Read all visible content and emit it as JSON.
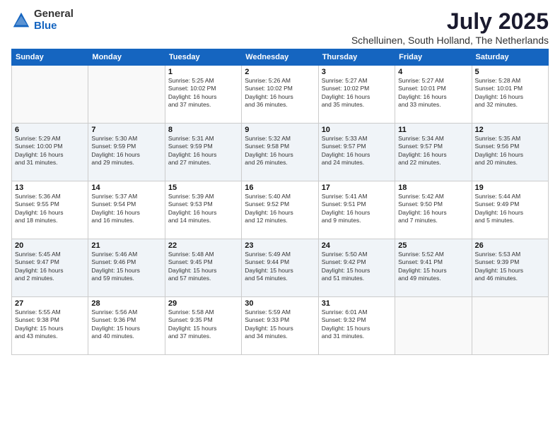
{
  "logo": {
    "general": "General",
    "blue": "Blue"
  },
  "title": "July 2025",
  "subtitle": "Schelluinen, South Holland, The Netherlands",
  "days_of_week": [
    "Sunday",
    "Monday",
    "Tuesday",
    "Wednesday",
    "Thursday",
    "Friday",
    "Saturday"
  ],
  "weeks": [
    [
      {
        "day": "",
        "info": ""
      },
      {
        "day": "",
        "info": ""
      },
      {
        "day": "1",
        "info": "Sunrise: 5:25 AM\nSunset: 10:02 PM\nDaylight: 16 hours\nand 37 minutes."
      },
      {
        "day": "2",
        "info": "Sunrise: 5:26 AM\nSunset: 10:02 PM\nDaylight: 16 hours\nand 36 minutes."
      },
      {
        "day": "3",
        "info": "Sunrise: 5:27 AM\nSunset: 10:02 PM\nDaylight: 16 hours\nand 35 minutes."
      },
      {
        "day": "4",
        "info": "Sunrise: 5:27 AM\nSunset: 10:01 PM\nDaylight: 16 hours\nand 33 minutes."
      },
      {
        "day": "5",
        "info": "Sunrise: 5:28 AM\nSunset: 10:01 PM\nDaylight: 16 hours\nand 32 minutes."
      }
    ],
    [
      {
        "day": "6",
        "info": "Sunrise: 5:29 AM\nSunset: 10:00 PM\nDaylight: 16 hours\nand 31 minutes."
      },
      {
        "day": "7",
        "info": "Sunrise: 5:30 AM\nSunset: 9:59 PM\nDaylight: 16 hours\nand 29 minutes."
      },
      {
        "day": "8",
        "info": "Sunrise: 5:31 AM\nSunset: 9:59 PM\nDaylight: 16 hours\nand 27 minutes."
      },
      {
        "day": "9",
        "info": "Sunrise: 5:32 AM\nSunset: 9:58 PM\nDaylight: 16 hours\nand 26 minutes."
      },
      {
        "day": "10",
        "info": "Sunrise: 5:33 AM\nSunset: 9:57 PM\nDaylight: 16 hours\nand 24 minutes."
      },
      {
        "day": "11",
        "info": "Sunrise: 5:34 AM\nSunset: 9:57 PM\nDaylight: 16 hours\nand 22 minutes."
      },
      {
        "day": "12",
        "info": "Sunrise: 5:35 AM\nSunset: 9:56 PM\nDaylight: 16 hours\nand 20 minutes."
      }
    ],
    [
      {
        "day": "13",
        "info": "Sunrise: 5:36 AM\nSunset: 9:55 PM\nDaylight: 16 hours\nand 18 minutes."
      },
      {
        "day": "14",
        "info": "Sunrise: 5:37 AM\nSunset: 9:54 PM\nDaylight: 16 hours\nand 16 minutes."
      },
      {
        "day": "15",
        "info": "Sunrise: 5:39 AM\nSunset: 9:53 PM\nDaylight: 16 hours\nand 14 minutes."
      },
      {
        "day": "16",
        "info": "Sunrise: 5:40 AM\nSunset: 9:52 PM\nDaylight: 16 hours\nand 12 minutes."
      },
      {
        "day": "17",
        "info": "Sunrise: 5:41 AM\nSunset: 9:51 PM\nDaylight: 16 hours\nand 9 minutes."
      },
      {
        "day": "18",
        "info": "Sunrise: 5:42 AM\nSunset: 9:50 PM\nDaylight: 16 hours\nand 7 minutes."
      },
      {
        "day": "19",
        "info": "Sunrise: 5:44 AM\nSunset: 9:49 PM\nDaylight: 16 hours\nand 5 minutes."
      }
    ],
    [
      {
        "day": "20",
        "info": "Sunrise: 5:45 AM\nSunset: 9:47 PM\nDaylight: 16 hours\nand 2 minutes."
      },
      {
        "day": "21",
        "info": "Sunrise: 5:46 AM\nSunset: 9:46 PM\nDaylight: 15 hours\nand 59 minutes."
      },
      {
        "day": "22",
        "info": "Sunrise: 5:48 AM\nSunset: 9:45 PM\nDaylight: 15 hours\nand 57 minutes."
      },
      {
        "day": "23",
        "info": "Sunrise: 5:49 AM\nSunset: 9:44 PM\nDaylight: 15 hours\nand 54 minutes."
      },
      {
        "day": "24",
        "info": "Sunrise: 5:50 AM\nSunset: 9:42 PM\nDaylight: 15 hours\nand 51 minutes."
      },
      {
        "day": "25",
        "info": "Sunrise: 5:52 AM\nSunset: 9:41 PM\nDaylight: 15 hours\nand 49 minutes."
      },
      {
        "day": "26",
        "info": "Sunrise: 5:53 AM\nSunset: 9:39 PM\nDaylight: 15 hours\nand 46 minutes."
      }
    ],
    [
      {
        "day": "27",
        "info": "Sunrise: 5:55 AM\nSunset: 9:38 PM\nDaylight: 15 hours\nand 43 minutes."
      },
      {
        "day": "28",
        "info": "Sunrise: 5:56 AM\nSunset: 9:36 PM\nDaylight: 15 hours\nand 40 minutes."
      },
      {
        "day": "29",
        "info": "Sunrise: 5:58 AM\nSunset: 9:35 PM\nDaylight: 15 hours\nand 37 minutes."
      },
      {
        "day": "30",
        "info": "Sunrise: 5:59 AM\nSunset: 9:33 PM\nDaylight: 15 hours\nand 34 minutes."
      },
      {
        "day": "31",
        "info": "Sunrise: 6:01 AM\nSunset: 9:32 PM\nDaylight: 15 hours\nand 31 minutes."
      },
      {
        "day": "",
        "info": ""
      },
      {
        "day": "",
        "info": ""
      }
    ]
  ]
}
